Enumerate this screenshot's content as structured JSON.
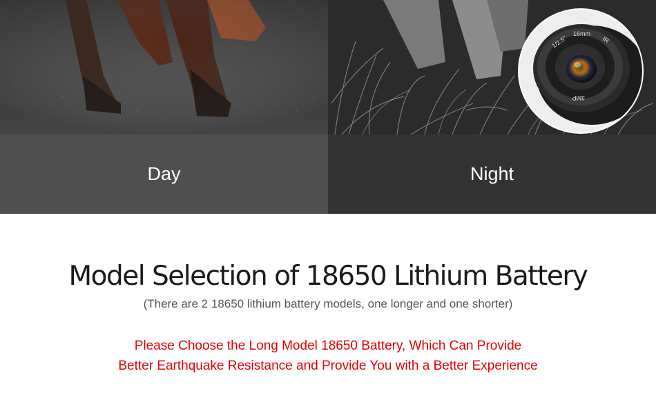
{
  "panels": {
    "day": {
      "label": "Day"
    },
    "night": {
      "label": "Night"
    }
  },
  "lens": {
    "aperture_text": "1/2.5\"",
    "focal_text": "16mm",
    "ir_text": "IR",
    "resolution_text": "3MP"
  },
  "section": {
    "title": "Model Selection of 18650 Lithium Battery",
    "subtitle": "(There are 2 18650 lithium battery models, one longer and one shorter)",
    "note_line1": "Please Choose the Long Model 18650 Battery, Which Can Provide",
    "note_line2": "Better Earthquake Resistance and Provide You with a Better Experience"
  },
  "colors": {
    "note": "#e60000",
    "day_band": "#4f4f4f",
    "night_band": "#333333"
  }
}
